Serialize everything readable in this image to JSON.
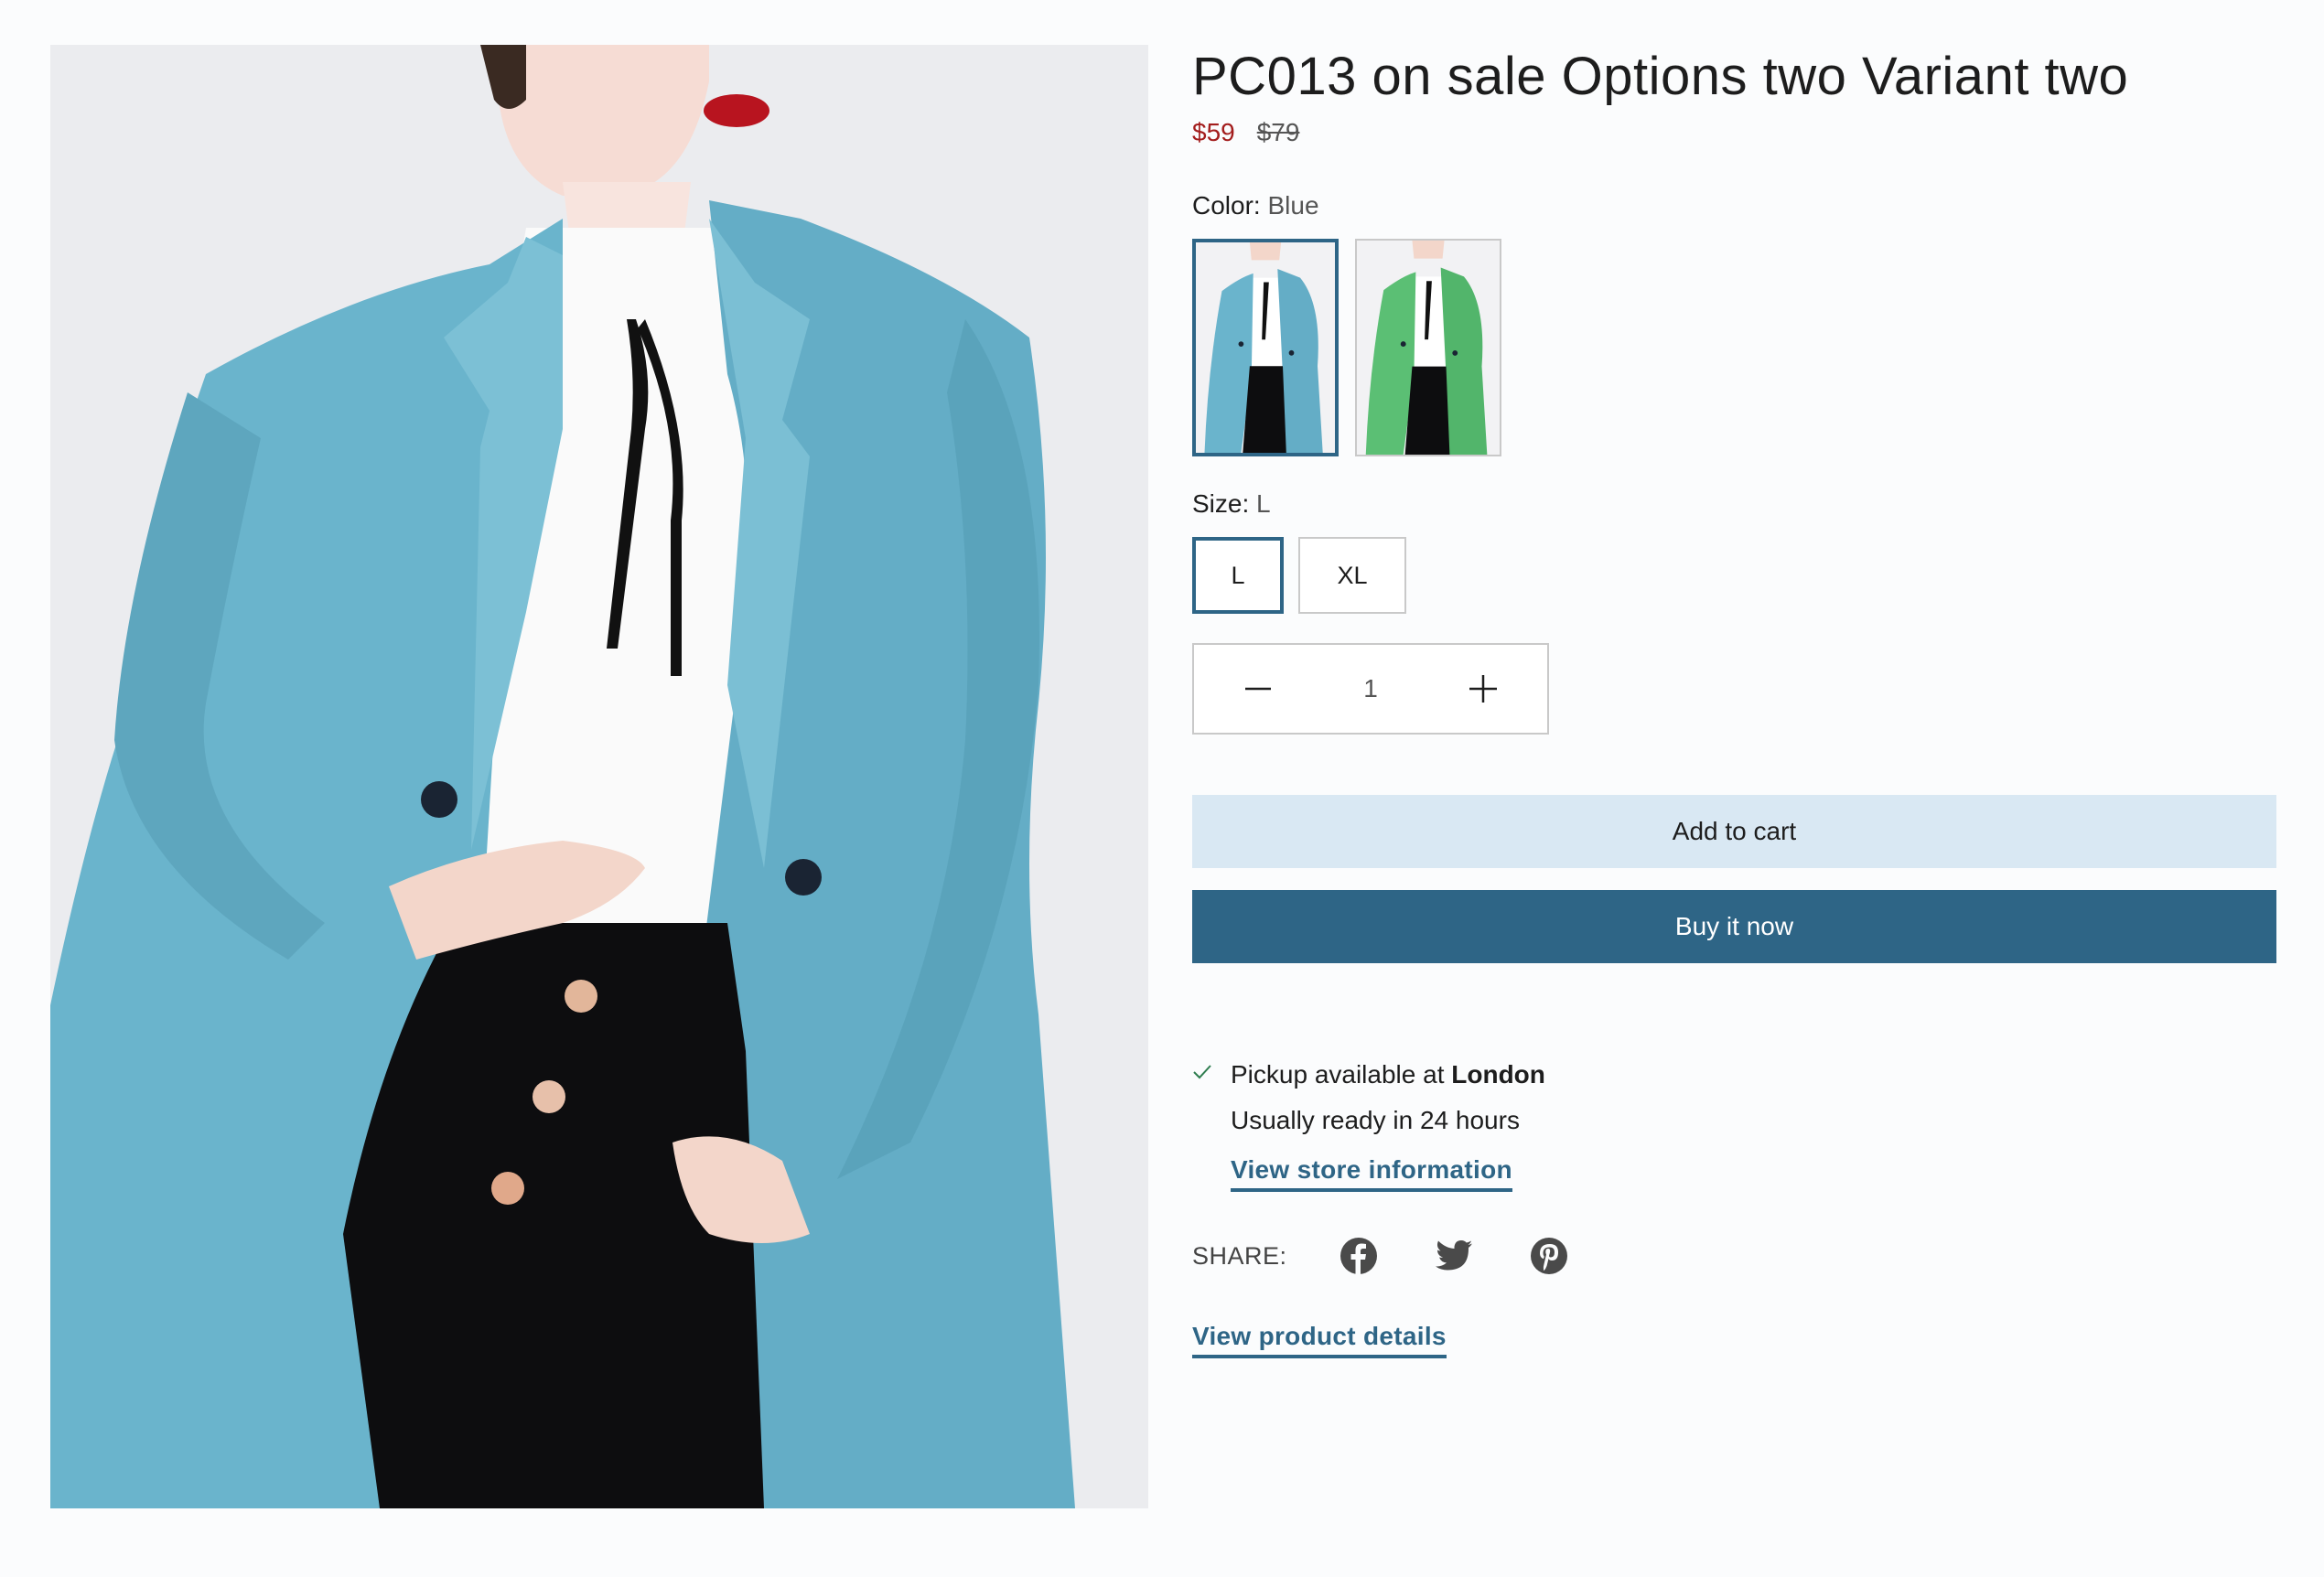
{
  "product": {
    "title": "PC013 on sale Options two Variant two",
    "price_sale": "$59",
    "price_compare": "$79",
    "hero_alt": "Woman wearing a blue long coat over a white blouse and black skirt"
  },
  "options": {
    "color": {
      "label": "Color:",
      "selected": "Blue",
      "swatches": [
        {
          "name": "Blue",
          "coat_color": "#6ab4cc"
        },
        {
          "name": "Green",
          "coat_color": "#5bbf74"
        }
      ]
    },
    "size": {
      "label": "Size:",
      "selected": "L",
      "values": [
        "L",
        "XL"
      ]
    }
  },
  "quantity": {
    "value": "1",
    "decrease_icon": "minus-icon",
    "increase_icon": "plus-icon"
  },
  "actions": {
    "add_to_cart": "Add to cart",
    "buy_now": "Buy it now"
  },
  "pickup": {
    "prefix": "Pickup available at",
    "location": "London",
    "ready": "Usually ready in 24 hours",
    "store_link": "View store information",
    "icon": "check-icon"
  },
  "share": {
    "label": "SHARE:",
    "networks": [
      "facebook-icon",
      "twitter-icon",
      "pinterest-icon"
    ]
  },
  "details_link": "View product details",
  "colors": {
    "accent": "#2e6586",
    "sale": "#a31d1d",
    "cart_bg": "#d9e8f3",
    "page_bg": "#fbfcfd"
  }
}
